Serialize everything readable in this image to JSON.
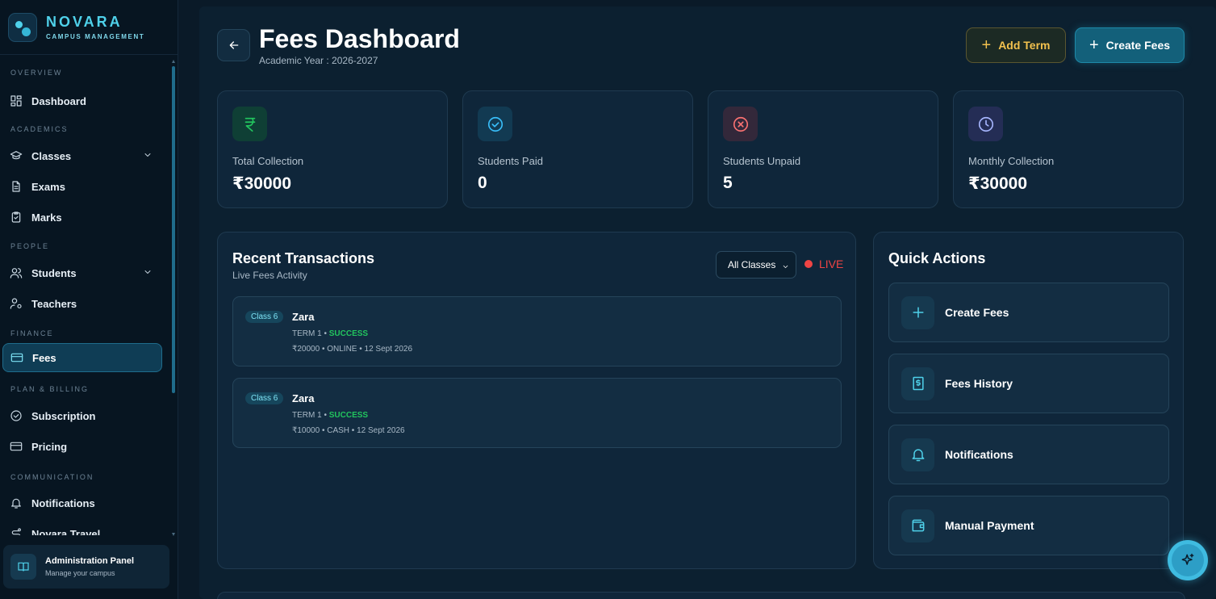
{
  "brand": {
    "name": "NOVARA",
    "tagline": "CAMPUS MANAGEMENT"
  },
  "sidebar": {
    "sections": {
      "overview": "OVERVIEW",
      "academics": "ACADEMICS",
      "people": "PEOPLE",
      "finance": "FINANCE",
      "plan_billing": "PLAN & BILLING",
      "communication": "COMMUNICATION"
    },
    "items": {
      "dashboard": "Dashboard",
      "classes": "Classes",
      "exams": "Exams",
      "marks": "Marks",
      "students": "Students",
      "teachers": "Teachers",
      "fees": "Fees",
      "subscription": "Subscription",
      "pricing": "Pricing",
      "notifications": "Notifications",
      "travel": "Novara Travel"
    },
    "active_item": "fees",
    "admin": {
      "title": "Administration Panel",
      "subtitle": "Manage your campus"
    }
  },
  "header": {
    "title": "Fees Dashboard",
    "subtitle": "Academic Year : 2026-2027",
    "add_term_label": "Add Term",
    "create_fees_label": "Create Fees"
  },
  "stats": [
    {
      "label": "Total Collection",
      "value": "₹30000",
      "icon": "rupee-icon",
      "color": "#22c55e"
    },
    {
      "label": "Students Paid",
      "value": "0",
      "icon": "check-circle-icon",
      "color": "#38bdf8"
    },
    {
      "label": "Students Unpaid",
      "value": "5",
      "icon": "x-circle-icon",
      "color": "#f87171"
    },
    {
      "label": "Monthly Collection",
      "value": "₹30000",
      "icon": "clock-icon",
      "color": "#a5b4fc"
    }
  ],
  "transactions": {
    "title": "Recent Transactions",
    "subtitle": "Live Fees Activity",
    "filter_value": "All Classes",
    "live_label": "LIVE",
    "items": [
      {
        "class": "Class 6",
        "name": "Zara",
        "term": "TERM 1",
        "status": "SUCCESS",
        "amount": "₹20000",
        "mode": "ONLINE",
        "date": "12 Sept 2026"
      },
      {
        "class": "Class 6",
        "name": "Zara",
        "term": "TERM 1",
        "status": "SUCCESS",
        "amount": "₹10000",
        "mode": "CASH",
        "date": "12 Sept 2026"
      }
    ]
  },
  "quick_actions": {
    "title": "Quick Actions",
    "items": [
      {
        "label": "Create Fees",
        "icon": "plus-icon"
      },
      {
        "label": "Fees History",
        "icon": "receipt-icon"
      },
      {
        "label": "Notifications",
        "icon": "bell-icon"
      },
      {
        "label": "Manual Payment",
        "icon": "wallet-icon"
      }
    ]
  },
  "colors": {
    "accent": "#4fd1ea",
    "success": "#22c55e",
    "live": "#ef4444",
    "term_button": "#f2c14e"
  }
}
